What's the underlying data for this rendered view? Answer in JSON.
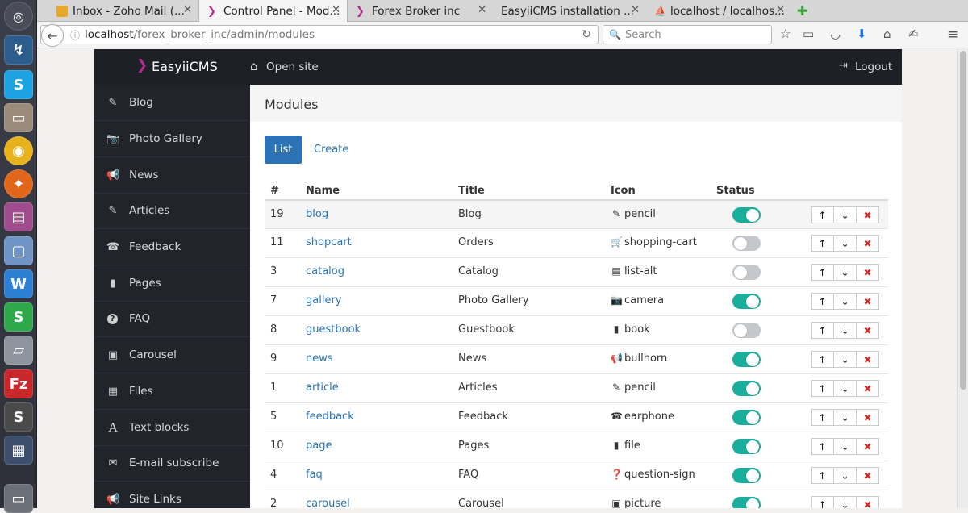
{
  "browser": {
    "tabs": [
      {
        "label": "Inbox - Zoho Mail (...",
        "icon": "envelope-icon",
        "active": false
      },
      {
        "label": "Control Panel - Mod...",
        "icon": "easyii-icon",
        "active": true
      },
      {
        "label": "Forex Broker inc",
        "icon": "easyii-icon",
        "active": false
      },
      {
        "label": "EasyiiCMS installation ...",
        "icon": "",
        "active": false
      },
      {
        "label": "localhost / localhos...",
        "icon": "phpmyadmin-icon",
        "active": false
      }
    ],
    "new_tab_label": "✚",
    "url_host": "localhost",
    "url_path": "/forex_broker_inc/admin/modules",
    "search_placeholder": "Search"
  },
  "app": {
    "brand": "EasyiiCMS",
    "open_site_label": "Open site",
    "logout_label": "Logout"
  },
  "sidebar": {
    "items": [
      {
        "label": "Blog",
        "icon": "pencil-icon",
        "glyph": "✎"
      },
      {
        "label": "Photo Gallery",
        "icon": "camera-icon",
        "glyph": "📷"
      },
      {
        "label": "News",
        "icon": "bullhorn-icon",
        "glyph": "📢"
      },
      {
        "label": "Articles",
        "icon": "pencil-icon",
        "glyph": "✎"
      },
      {
        "label": "Feedback",
        "icon": "earphone-icon",
        "glyph": "☎"
      },
      {
        "label": "Pages",
        "icon": "file-icon",
        "glyph": "▮"
      },
      {
        "label": "FAQ",
        "icon": "question-sign-icon",
        "glyph": "?"
      },
      {
        "label": "Carousel",
        "icon": "picture-icon",
        "glyph": "▣"
      },
      {
        "label": "Files",
        "icon": "floppy-disk-icon",
        "glyph": "▦"
      },
      {
        "label": "Text blocks",
        "icon": "font-icon",
        "glyph": "A"
      },
      {
        "label": "E-mail subscribe",
        "icon": "envelope-icon",
        "glyph": "✉"
      },
      {
        "label": "Site Links",
        "icon": "bullhorn-icon",
        "glyph": "📢"
      }
    ]
  },
  "content": {
    "title": "Modules",
    "tab_list": "List",
    "tab_create": "Create",
    "columns": {
      "id": "#",
      "name": "Name",
      "title": "Title",
      "icon": "Icon",
      "status": "Status"
    },
    "rows": [
      {
        "id": "19",
        "name": "blog",
        "title": "Blog",
        "icon_name": "pencil",
        "glyph": "✎",
        "status_on": true
      },
      {
        "id": "11",
        "name": "shopcart",
        "title": "Orders",
        "icon_name": "shopping-cart",
        "glyph": "🛒",
        "status_on": false
      },
      {
        "id": "3",
        "name": "catalog",
        "title": "Catalog",
        "icon_name": "list-alt",
        "glyph": "▤",
        "status_on": false
      },
      {
        "id": "7",
        "name": "gallery",
        "title": "Photo Gallery",
        "icon_name": "camera",
        "glyph": "📷",
        "status_on": true
      },
      {
        "id": "8",
        "name": "guestbook",
        "title": "Guestbook",
        "icon_name": "book",
        "glyph": "▮",
        "status_on": false
      },
      {
        "id": "9",
        "name": "news",
        "title": "News",
        "icon_name": "bullhorn",
        "glyph": "📢",
        "status_on": true
      },
      {
        "id": "1",
        "name": "article",
        "title": "Articles",
        "icon_name": "pencil",
        "glyph": "✎",
        "status_on": true
      },
      {
        "id": "5",
        "name": "feedback",
        "title": "Feedback",
        "icon_name": "earphone",
        "glyph": "☎",
        "status_on": true
      },
      {
        "id": "10",
        "name": "page",
        "title": "Pages",
        "icon_name": "file",
        "glyph": "▮",
        "status_on": true
      },
      {
        "id": "4",
        "name": "faq",
        "title": "FAQ",
        "icon_name": "question-sign",
        "glyph": "❓",
        "status_on": true
      },
      {
        "id": "2",
        "name": "carousel",
        "title": "Carousel",
        "icon_name": "picture",
        "glyph": "▣",
        "status_on": true
      }
    ],
    "action_up": "↑",
    "action_down": "↓",
    "action_delete": "✖"
  },
  "colors": {
    "accent": "#2b73b5",
    "toggle_on": "#1aaf9c",
    "toggle_off": "#c4c7cc",
    "sidebar_bg": "#22242b",
    "topbar_bg": "#1e2027",
    "delete": "#c9302c"
  }
}
